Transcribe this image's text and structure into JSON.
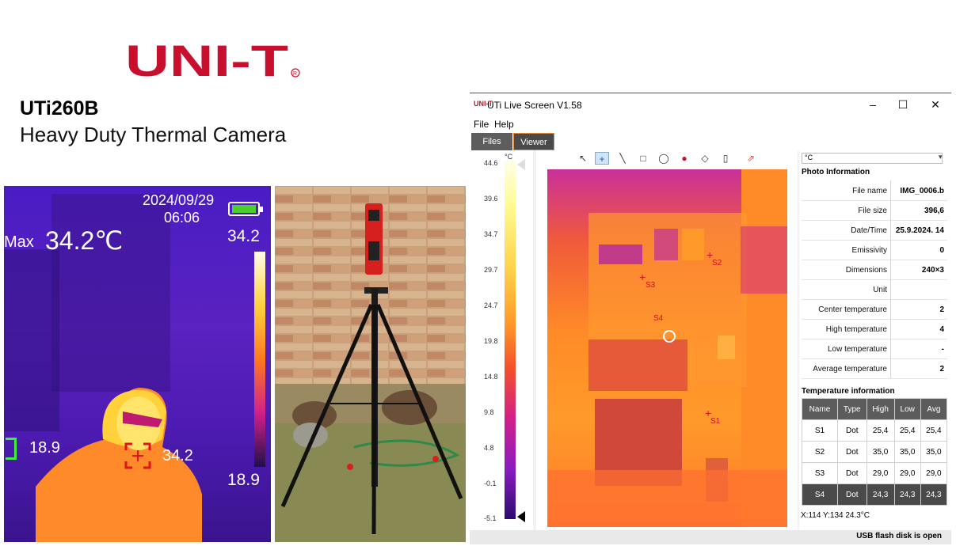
{
  "brand": {
    "logo_text": "UNI-T",
    "model": "UTi260B",
    "subtitle": "Heavy Duty Thermal Camera",
    "brand_color": "#c8102e"
  },
  "camera_view": {
    "date": "2024/09/29",
    "time": "06:06",
    "max_label": "Max",
    "max_value": "34.2℃",
    "scale_max": "34.2",
    "scale_min": "18.9",
    "cold_spot": "18.9",
    "hot_spot": "34.2"
  },
  "app": {
    "icon_text": "UNI-T",
    "title": "UTi Live Screen V1.58",
    "window_controls": {
      "minimize": "–",
      "maximize": "☐",
      "close": "✕"
    },
    "menu": [
      "File",
      "Help"
    ],
    "tabs": [
      "Files",
      "Viewer"
    ],
    "active_tab": "Viewer",
    "palette": {
      "unit": "°C",
      "ticks": [
        "44.6",
        "39.6",
        "34.7",
        "29.7",
        "24.7",
        "19.8",
        "14.8",
        "9.8",
        "4.8",
        "-0.1",
        "-5.1"
      ]
    },
    "toolbar_icons": [
      "pointer-icon",
      "crosshair-icon",
      "line-icon",
      "rectangle-icon",
      "ellipse-icon",
      "palette-icon",
      "eraser-icon",
      "delete-icon",
      "export-icon"
    ],
    "spots": [
      "S1",
      "S2",
      "S3",
      "S4"
    ],
    "unit_select": "°C",
    "photo_info": {
      "title": "Photo Information",
      "rows": [
        {
          "label": "File name",
          "value": "IMG_0006.b"
        },
        {
          "label": "File size",
          "value": "396,6"
        },
        {
          "label": "Date/Time",
          "value": "25.9.2024. 14"
        },
        {
          "label": "Emissivity",
          "value": "0"
        },
        {
          "label": "Dimensions",
          "value": "240×3"
        },
        {
          "label": "Unit",
          "value": ""
        },
        {
          "label": "Center temperature",
          "value": "2"
        },
        {
          "label": "High temperature",
          "value": "4"
        },
        {
          "label": "Low temperature",
          "value": "-"
        },
        {
          "label": "Average temperature",
          "value": "2"
        }
      ]
    },
    "temp_info": {
      "title": "Temperature information",
      "headers": [
        "Name",
        "Type",
        "High",
        "Low",
        "Avg"
      ],
      "rows": [
        [
          "S1",
          "Dot",
          "25,4",
          "25,4",
          "25,4"
        ],
        [
          "S2",
          "Dot",
          "35,0",
          "35,0",
          "35,0"
        ],
        [
          "S3",
          "Dot",
          "29,0",
          "29,0",
          "29,0"
        ],
        [
          "S4",
          "Dot",
          "24,3",
          "24,3",
          "24,3"
        ]
      ],
      "selected_row": 3
    },
    "coords": "X:114 Y:134   24.3°C",
    "status": "USB flash disk is open"
  }
}
